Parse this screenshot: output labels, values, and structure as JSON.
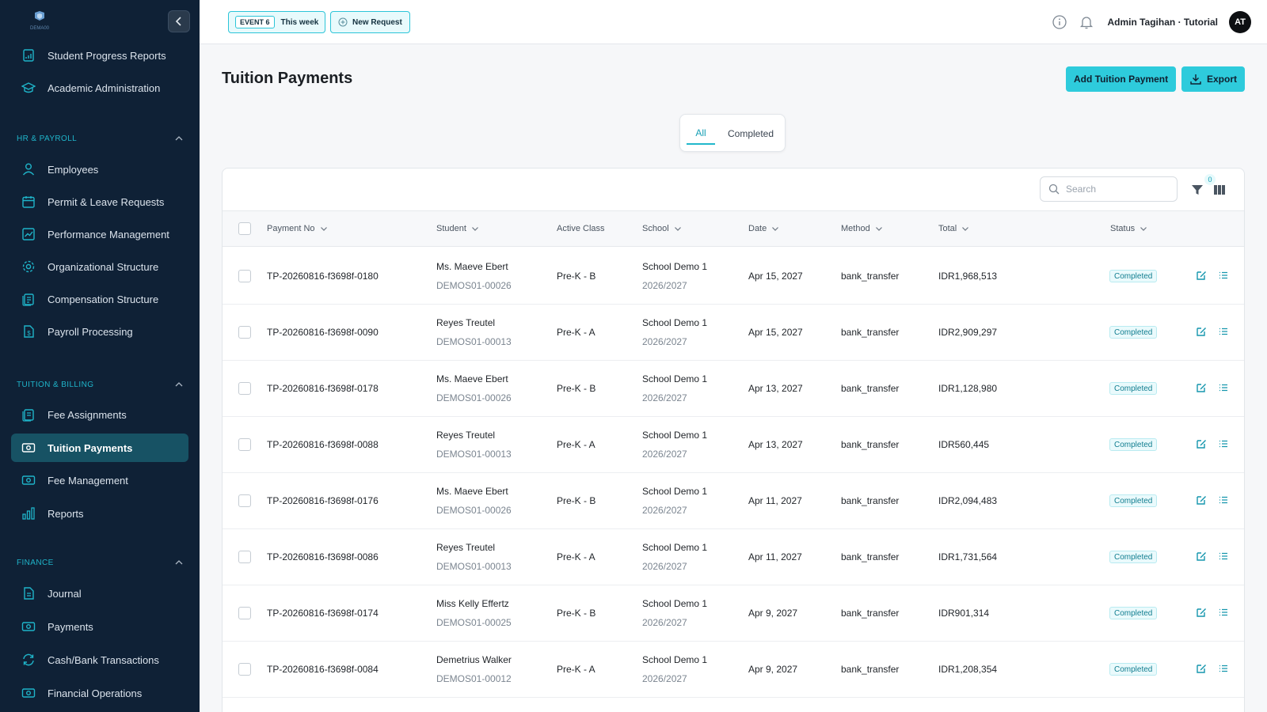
{
  "app": {
    "logo_text": "DEMA00"
  },
  "sidebar": {
    "top_items": [
      {
        "label": "Student Progress Reports",
        "icon": "report-icon"
      },
      {
        "label": "Academic Administration",
        "icon": "graduation-cap-icon"
      }
    ],
    "sections": [
      {
        "title": "HR & PAYROLL",
        "items": [
          {
            "label": "Employees",
            "icon": "person-icon"
          },
          {
            "label": "Permit & Leave Requests",
            "icon": "calendar-icon"
          },
          {
            "label": "Performance Management",
            "icon": "chart-line-icon"
          },
          {
            "label": "Organizational Structure",
            "icon": "gear-icon"
          },
          {
            "label": "Compensation Structure",
            "icon": "document-stack-icon"
          },
          {
            "label": "Payroll Processing",
            "icon": "dollar-document-icon"
          }
        ]
      },
      {
        "title": "TUITION & BILLING",
        "items": [
          {
            "label": "Fee Assignments",
            "icon": "document-stack-icon"
          },
          {
            "label": "Tuition Payments",
            "icon": "money-icon",
            "active": true
          },
          {
            "label": "Fee Management",
            "icon": "money-icon"
          },
          {
            "label": "Reports",
            "icon": "bar-chart-icon"
          }
        ]
      },
      {
        "title": "FINANCE",
        "items": [
          {
            "label": "Journal",
            "icon": "document-icon"
          },
          {
            "label": "Payments",
            "icon": "money-icon"
          },
          {
            "label": "Cash/Bank Transactions",
            "icon": "refresh-icon"
          },
          {
            "label": "Financial Operations",
            "icon": "money-icon"
          }
        ]
      }
    ]
  },
  "topbar": {
    "event_badge": "EVENT 6",
    "event_label": "This week",
    "new_request_label": "New Request",
    "user_name": "Admin Tagihan · Tutorial",
    "avatar_initials": "AT"
  },
  "page": {
    "title": "Tuition Payments",
    "add_button": "Add Tuition Payment",
    "export_button": "Export",
    "tabs": [
      "All",
      "Completed"
    ],
    "active_tab": "All",
    "search_placeholder": "Search",
    "filter_count": "0"
  },
  "table": {
    "columns": [
      "Payment No",
      "Student",
      "Active Class",
      "School",
      "Date",
      "Method",
      "Total",
      "Status"
    ],
    "rows": [
      {
        "payment_no": "TP-20260816-f3698f-0180",
        "student": "Ms. Maeve Ebert",
        "student_id": "DEMOS01-00026",
        "class": "Pre-K - B",
        "school": "School Demo 1",
        "year": "2026/2027",
        "date": "Apr 15, 2027",
        "method": "bank_transfer",
        "total": "IDR1,968,513",
        "status": "Completed"
      },
      {
        "payment_no": "TP-20260816-f3698f-0090",
        "student": "Reyes Treutel",
        "student_id": "DEMOS01-00013",
        "class": "Pre-K - A",
        "school": "School Demo 1",
        "year": "2026/2027",
        "date": "Apr 15, 2027",
        "method": "bank_transfer",
        "total": "IDR2,909,297",
        "status": "Completed"
      },
      {
        "payment_no": "TP-20260816-f3698f-0178",
        "student": "Ms. Maeve Ebert",
        "student_id": "DEMOS01-00026",
        "class": "Pre-K - B",
        "school": "School Demo 1",
        "year": "2026/2027",
        "date": "Apr 13, 2027",
        "method": "bank_transfer",
        "total": "IDR1,128,980",
        "status": "Completed"
      },
      {
        "payment_no": "TP-20260816-f3698f-0088",
        "student": "Reyes Treutel",
        "student_id": "DEMOS01-00013",
        "class": "Pre-K - A",
        "school": "School Demo 1",
        "year": "2026/2027",
        "date": "Apr 13, 2027",
        "method": "bank_transfer",
        "total": "IDR560,445",
        "status": "Completed"
      },
      {
        "payment_no": "TP-20260816-f3698f-0176",
        "student": "Ms. Maeve Ebert",
        "student_id": "DEMOS01-00026",
        "class": "Pre-K - B",
        "school": "School Demo 1",
        "year": "2026/2027",
        "date": "Apr 11, 2027",
        "method": "bank_transfer",
        "total": "IDR2,094,483",
        "status": "Completed"
      },
      {
        "payment_no": "TP-20260816-f3698f-0086",
        "student": "Reyes Treutel",
        "student_id": "DEMOS01-00013",
        "class": "Pre-K - A",
        "school": "School Demo 1",
        "year": "2026/2027",
        "date": "Apr 11, 2027",
        "method": "bank_transfer",
        "total": "IDR1,731,564",
        "status": "Completed"
      },
      {
        "payment_no": "TP-20260816-f3698f-0174",
        "student": "Miss Kelly Effertz",
        "student_id": "DEMOS01-00025",
        "class": "Pre-K - B",
        "school": "School Demo 1",
        "year": "2026/2027",
        "date": "Apr 9, 2027",
        "method": "bank_transfer",
        "total": "IDR901,314",
        "status": "Completed"
      },
      {
        "payment_no": "TP-20260816-f3698f-0084",
        "student": "Demetrius Walker",
        "student_id": "DEMOS01-00012",
        "class": "Pre-K - A",
        "school": "School Demo 1",
        "year": "2026/2027",
        "date": "Apr 9, 2027",
        "method": "bank_transfer",
        "total": "IDR1,208,354",
        "status": "Completed"
      }
    ]
  },
  "colors": {
    "sidebar_bg": "#0f2136",
    "accent": "#2ecbdc",
    "active_nav": "#175264",
    "status_text": "#117e90"
  }
}
